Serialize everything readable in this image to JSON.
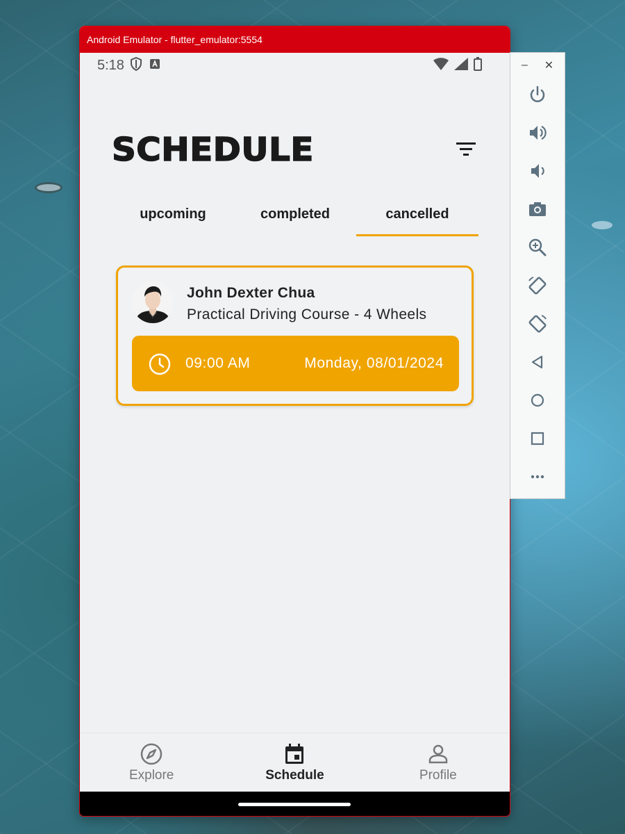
{
  "window": {
    "title": "Android Emulator - flutter_emulator:5554"
  },
  "status_bar": {
    "time": "5:18"
  },
  "app": {
    "title": "SCHEDULE",
    "tabs": [
      {
        "label": "upcoming",
        "active": false
      },
      {
        "label": "completed",
        "active": false
      },
      {
        "label": "cancelled",
        "active": true
      }
    ],
    "schedule_card": {
      "instructor": "John Dexter Chua",
      "course": "Practical Driving Course - 4 Wheels",
      "time": "09:00 AM",
      "date": "Monday, 08/01/2024"
    },
    "bottom_nav": [
      {
        "label": "Explore",
        "icon": "compass-icon",
        "active": false
      },
      {
        "label": "Schedule",
        "icon": "calendar-icon",
        "active": true
      },
      {
        "label": "Profile",
        "icon": "person-icon",
        "active": false
      }
    ]
  },
  "emulator_toolbar": {
    "minimize": "–",
    "close": "✕",
    "buttons": [
      "power-icon",
      "volume-up-icon",
      "volume-down-icon",
      "camera-icon",
      "zoom-icon",
      "rotate-left-icon",
      "rotate-right-icon",
      "back-icon",
      "home-icon",
      "overview-icon",
      "more-icon"
    ]
  },
  "colors": {
    "accent": "#f0a400",
    "title_bar": "#d4000f",
    "background": "#eff1f3"
  }
}
